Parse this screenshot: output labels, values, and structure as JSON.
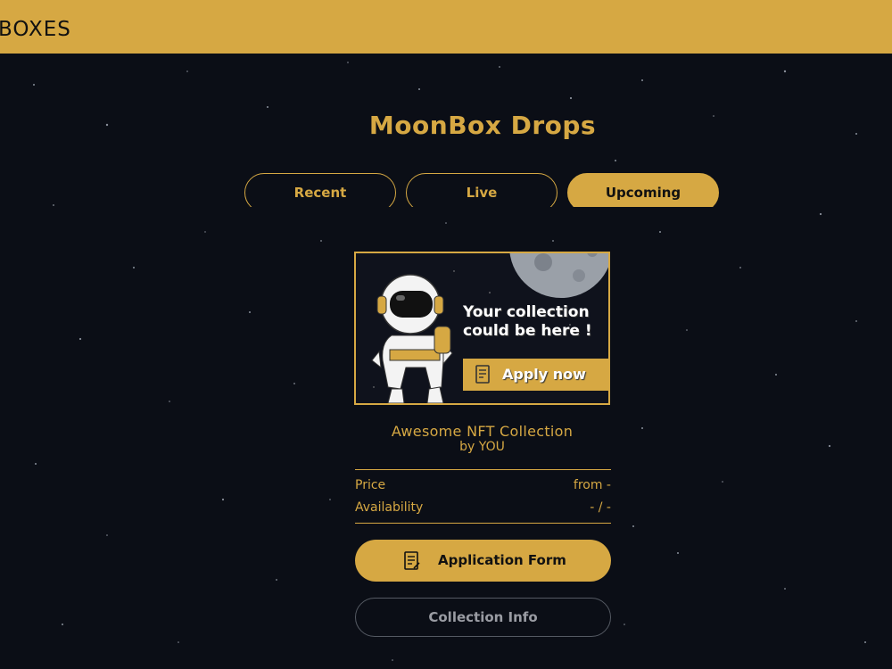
{
  "header": {
    "brand": "BOXES"
  },
  "page": {
    "title": "MoonBox Drops"
  },
  "tabs": [
    {
      "label": "Recent",
      "active": false
    },
    {
      "label": "Live",
      "active": false
    },
    {
      "label": "Upcoming",
      "active": true
    }
  ],
  "banner": {
    "line1": "Your collection",
    "line2": "could be here !",
    "apply_label": "Apply now"
  },
  "collection": {
    "title": "Awesome NFT Collection",
    "by": "by YOU",
    "price_label": "Price",
    "price_value": "from -",
    "availability_label": "Availability",
    "availability_value": "- / -"
  },
  "buttons": {
    "application_form": "Application Form",
    "collection_info": "Collection Info"
  },
  "colors": {
    "accent": "#d6a843",
    "background": "#0b0e16",
    "muted_border": "#555a63"
  }
}
